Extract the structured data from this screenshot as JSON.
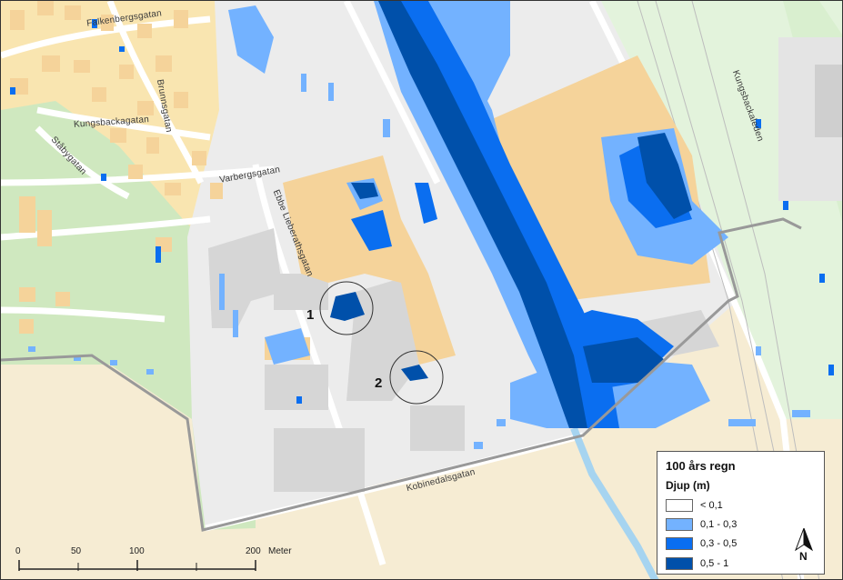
{
  "map": {
    "street_labels": [
      "Falkenbergsgatan",
      "Brunnsgatan",
      "Kungsbackagatan",
      "Ståbygatan",
      "Varbergsgatan",
      "Ebbe Lieberathsgatan",
      "Kungsbackaleden",
      "Kobinedalsgatan"
    ],
    "markers": [
      "1",
      "2"
    ],
    "colors": {
      "background": "#f6ecd3",
      "residential": "#f9e5b0",
      "building_yellow": "#f5d39a",
      "building_grey": "#d6d6d6",
      "industrial": "#ececec",
      "park": "#cfe8bf",
      "railway": "#e3f3dc",
      "boundary": "#999999",
      "depth_lt_01": "#ffffff",
      "depth_01_03": "#73b2ff",
      "depth_03_05": "#0a6ef0",
      "depth_05_1": "#0050aa"
    }
  },
  "legend": {
    "title": "100 års regn",
    "subtitle": "Djup (m)",
    "items": [
      {
        "label": "< 0,1",
        "color": "#ffffff"
      },
      {
        "label": "0,1 - 0,3",
        "color": "#73b2ff"
      },
      {
        "label": "0,3 - 0,5",
        "color": "#0a6ef0"
      },
      {
        "label": "0,5 - 1",
        "color": "#0050aa"
      }
    ],
    "north_label": "N"
  },
  "scale": {
    "ticks": [
      "0",
      "50",
      "100",
      "200"
    ],
    "unit": "Meter"
  }
}
